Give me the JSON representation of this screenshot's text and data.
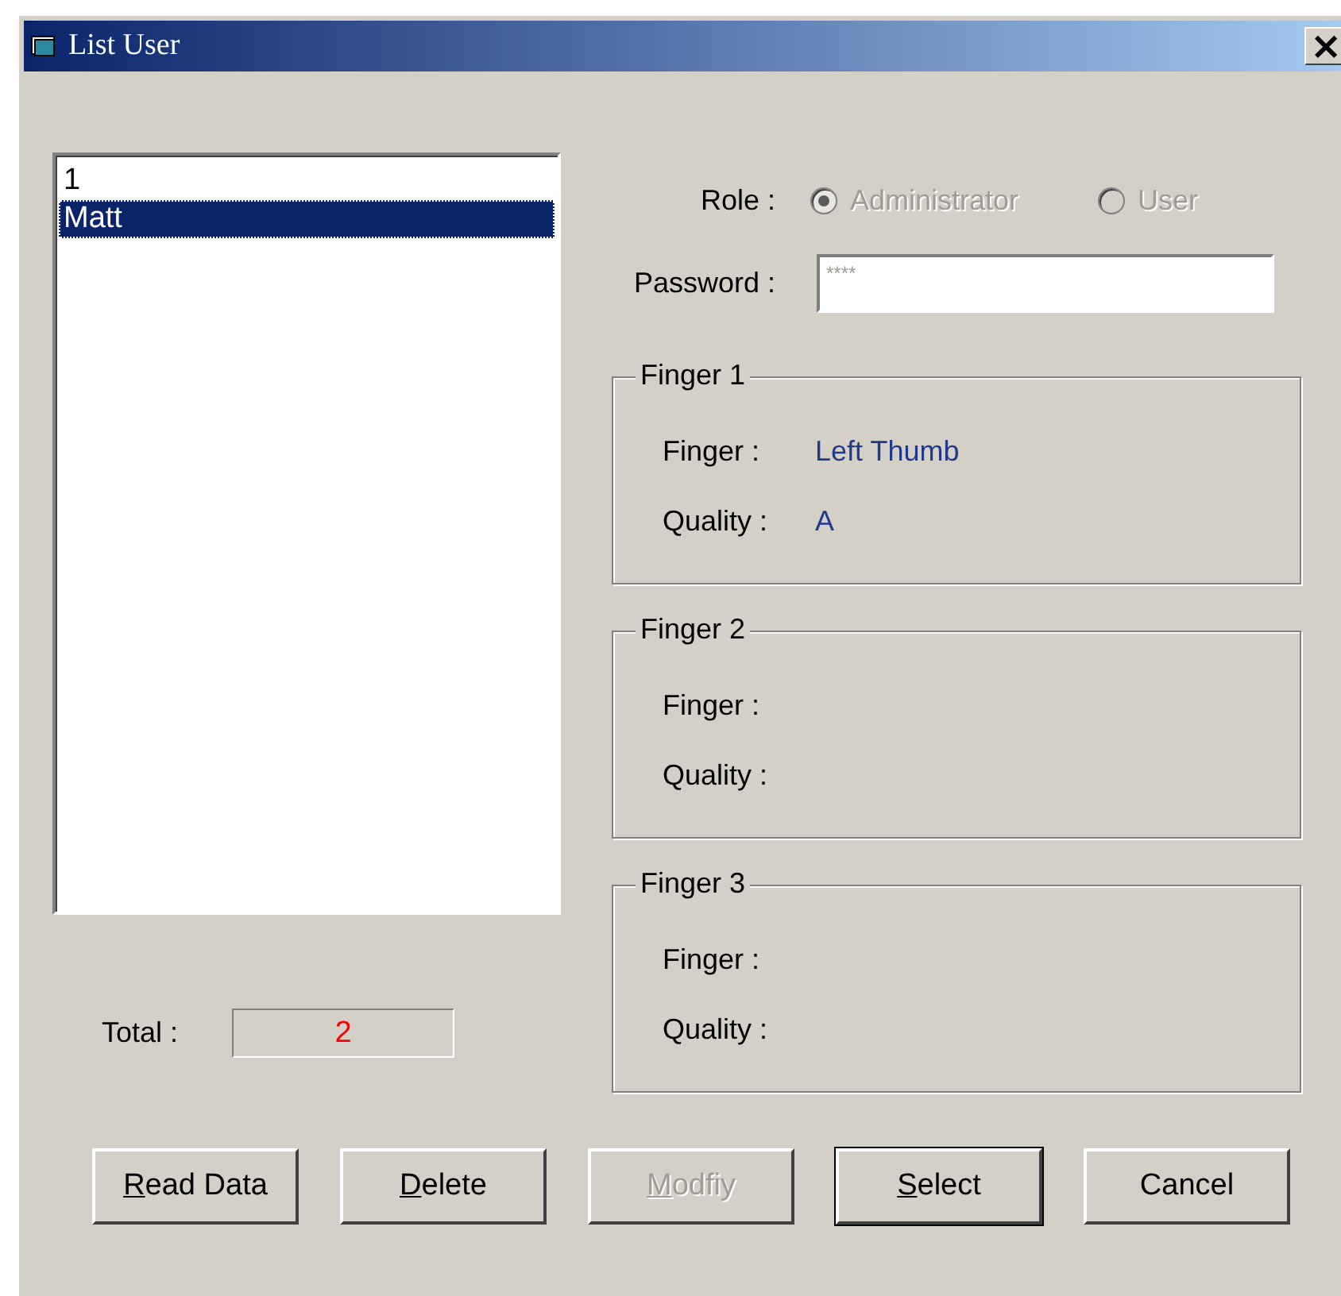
{
  "window": {
    "title": "List User",
    "close": "×"
  },
  "users": [
    {
      "label": "1",
      "selected": false
    },
    {
      "label": "Matt",
      "selected": true
    }
  ],
  "total": {
    "label": "Total :",
    "value": "2"
  },
  "role": {
    "label": "Role :",
    "options": [
      {
        "label": "Administrator",
        "selected": true,
        "disabled": true
      },
      {
        "label": "User",
        "selected": false,
        "disabled": true
      }
    ]
  },
  "password": {
    "label": "Password :",
    "value": "****"
  },
  "fingers": [
    {
      "title": "Finger 1",
      "finger_label": "Finger :",
      "finger": "Left Thumb",
      "quality_label": "Quality :",
      "quality": "A"
    },
    {
      "title": "Finger 2",
      "finger_label": "Finger :",
      "quality_label": "Quality :"
    },
    {
      "title": "Finger 3",
      "finger_label": "Finger :",
      "quality_label": "Quality :"
    }
  ],
  "buttons": [
    {
      "label": "Read Data",
      "underline_first": true,
      "disabled": false,
      "default": false
    },
    {
      "label": "Delete",
      "underline_first": true,
      "disabled": false,
      "default": false
    },
    {
      "label": "Modfiy",
      "underline_first": true,
      "disabled": true,
      "default": false
    },
    {
      "label": "Select",
      "underline_first": true,
      "disabled": false,
      "default": true
    },
    {
      "label": "Cancel",
      "underline_first": false,
      "disabled": false,
      "default": false
    }
  ]
}
